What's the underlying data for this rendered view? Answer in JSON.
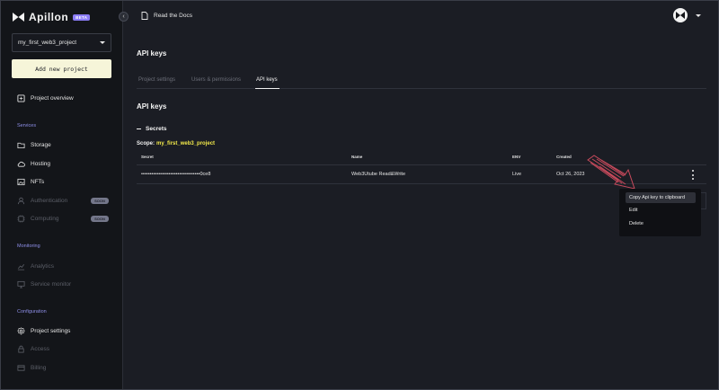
{
  "sidebar": {
    "logo": "Apillon",
    "beta_badge": "BETA",
    "project_name": "my_first_web3_project",
    "add_project": "Add new project",
    "project_overview": "Project overview",
    "sections": {
      "services": "Services",
      "monitoring": "Monitoring",
      "configuration": "Configuration"
    },
    "services": [
      {
        "label": "Storage",
        "icon": "folder-icon"
      },
      {
        "label": "Hosting",
        "icon": "cloud-icon"
      },
      {
        "label": "NFTs",
        "icon": "image-icon"
      },
      {
        "label": "Authentication",
        "icon": "user-icon",
        "soon": "SOON"
      },
      {
        "label": "Computing",
        "icon": "chip-icon",
        "soon": "SOON"
      }
    ],
    "monitoring": [
      {
        "label": "Analytics",
        "icon": "chart-icon"
      },
      {
        "label": "Service monitor",
        "icon": "monitor-icon"
      }
    ],
    "configuration": [
      {
        "label": "Project settings",
        "icon": "gear-icon"
      },
      {
        "label": "Access",
        "icon": "lock-icon"
      },
      {
        "label": "Billing",
        "icon": "card-icon"
      }
    ]
  },
  "topbar": {
    "docs_link": "Read the Docs"
  },
  "main": {
    "title": "API keys",
    "tabs": [
      {
        "label": "Project settings",
        "active": false
      },
      {
        "label": "Users & permissions",
        "active": false
      },
      {
        "label": "API keys",
        "active": true
      }
    ],
    "section_title": "API keys",
    "secrets_label": "Secrets",
    "scope_label": "Scope:",
    "scope_value": "my_first_web3_project",
    "table": {
      "columns": [
        "Secret",
        "Name",
        "ENV",
        "Created"
      ],
      "rows": [
        {
          "secret": "••••••••••••••••••••••••••••••••••0ce8",
          "name": "Web3Utube Read&Write",
          "env": "Live",
          "created": "Oct 26, 2023"
        }
      ]
    },
    "context_menu": [
      "Copy Api key to clipboard",
      "Edit",
      "Delete"
    ]
  },
  "colors": {
    "background": "#1b1d24",
    "sidebar": "#131519",
    "accent_yellow": "#f2e94a",
    "section_label": "#8e8fe8",
    "button_bg": "#f6f5d9",
    "annotation_arrow": "#c84a5c"
  }
}
